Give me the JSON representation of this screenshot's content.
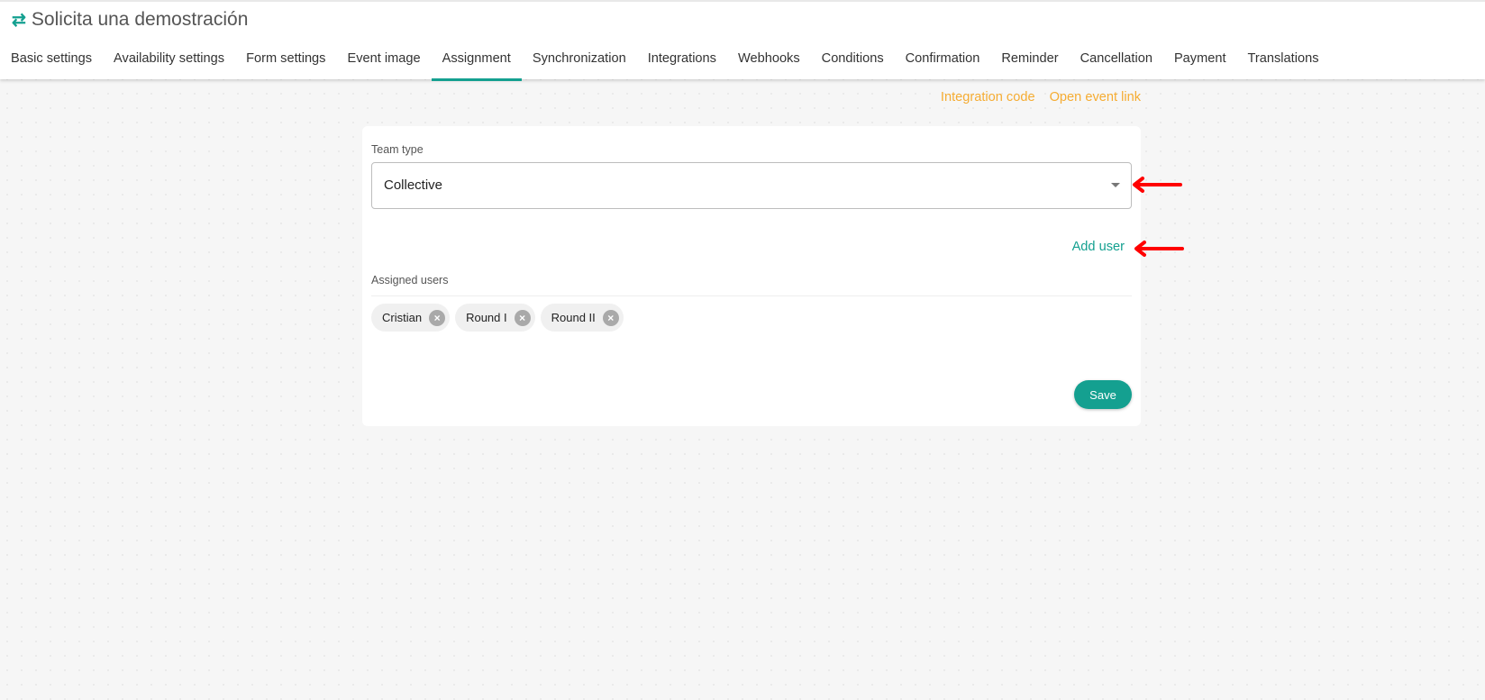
{
  "header": {
    "title": "Solicita una demostración",
    "icon": "swap-arrows-icon"
  },
  "tabs": [
    {
      "label": "Basic settings"
    },
    {
      "label": "Availability settings"
    },
    {
      "label": "Form settings"
    },
    {
      "label": "Event image"
    },
    {
      "label": "Assignment",
      "active": true
    },
    {
      "label": "Synchronization"
    },
    {
      "label": "Integrations"
    },
    {
      "label": "Webhooks"
    },
    {
      "label": "Conditions"
    },
    {
      "label": "Confirmation"
    },
    {
      "label": "Reminder"
    },
    {
      "label": "Cancellation"
    },
    {
      "label": "Payment"
    },
    {
      "label": "Translations"
    }
  ],
  "links": {
    "integration_code": "Integration code",
    "open_event_link": "Open event link"
  },
  "form": {
    "team_type_label": "Team type",
    "team_type_value": "Collective",
    "add_user": "Add user",
    "assigned_users_label": "Assigned users",
    "assigned_users": [
      "Cristian",
      "Round I",
      "Round II"
    ],
    "save": "Save"
  },
  "colors": {
    "accent": "#14a090",
    "link": "#f5ac32",
    "annotation_arrow": "#ff0000"
  }
}
